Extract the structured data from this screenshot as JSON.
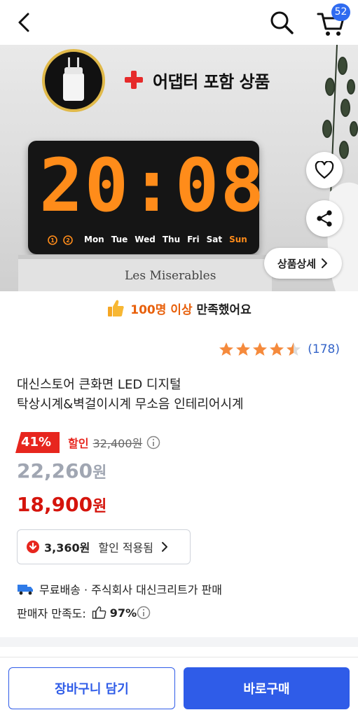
{
  "header": {
    "cart_count": "52"
  },
  "hero": {
    "promo_text": "어댑터 포함 상품",
    "clock_time": "20:08",
    "days": [
      "Mon",
      "Tue",
      "Wed",
      "Thu",
      "Fri",
      "Sat",
      "Sun"
    ],
    "active_day": "Sun",
    "book_title": "Les Miserables",
    "detail_label": "상품상세"
  },
  "satisfaction": {
    "highlight": "100명 이상",
    "rest": " 만족했어요"
  },
  "rating": {
    "stars": 4.5,
    "count": "(178)"
  },
  "product": {
    "title_line1": "대신스토어 큰화면 LED 디지털",
    "title_line2": "탁상시계&벽걸이시계 무소음 인테리어시계"
  },
  "price": {
    "discount_pct": "41%",
    "discount_label": "할인",
    "original": "32,400원",
    "price1": "22,260",
    "price2": "18,900",
    "won": "원",
    "applied_amount": "3,360원",
    "applied_label": "할인 적용됨"
  },
  "shipping": {
    "text": "무료배송 · 주식회사 대신크리트가 판매"
  },
  "seller": {
    "label": "판매자 만족도:",
    "value": "97%"
  },
  "actions": {
    "cart_label": "장바구니 담기",
    "buy_label": "바로구매"
  },
  "colors": {
    "accent_blue": "#2f5ce8",
    "sale_red": "#d5140c",
    "clock_orange": "#ff8c1a"
  }
}
